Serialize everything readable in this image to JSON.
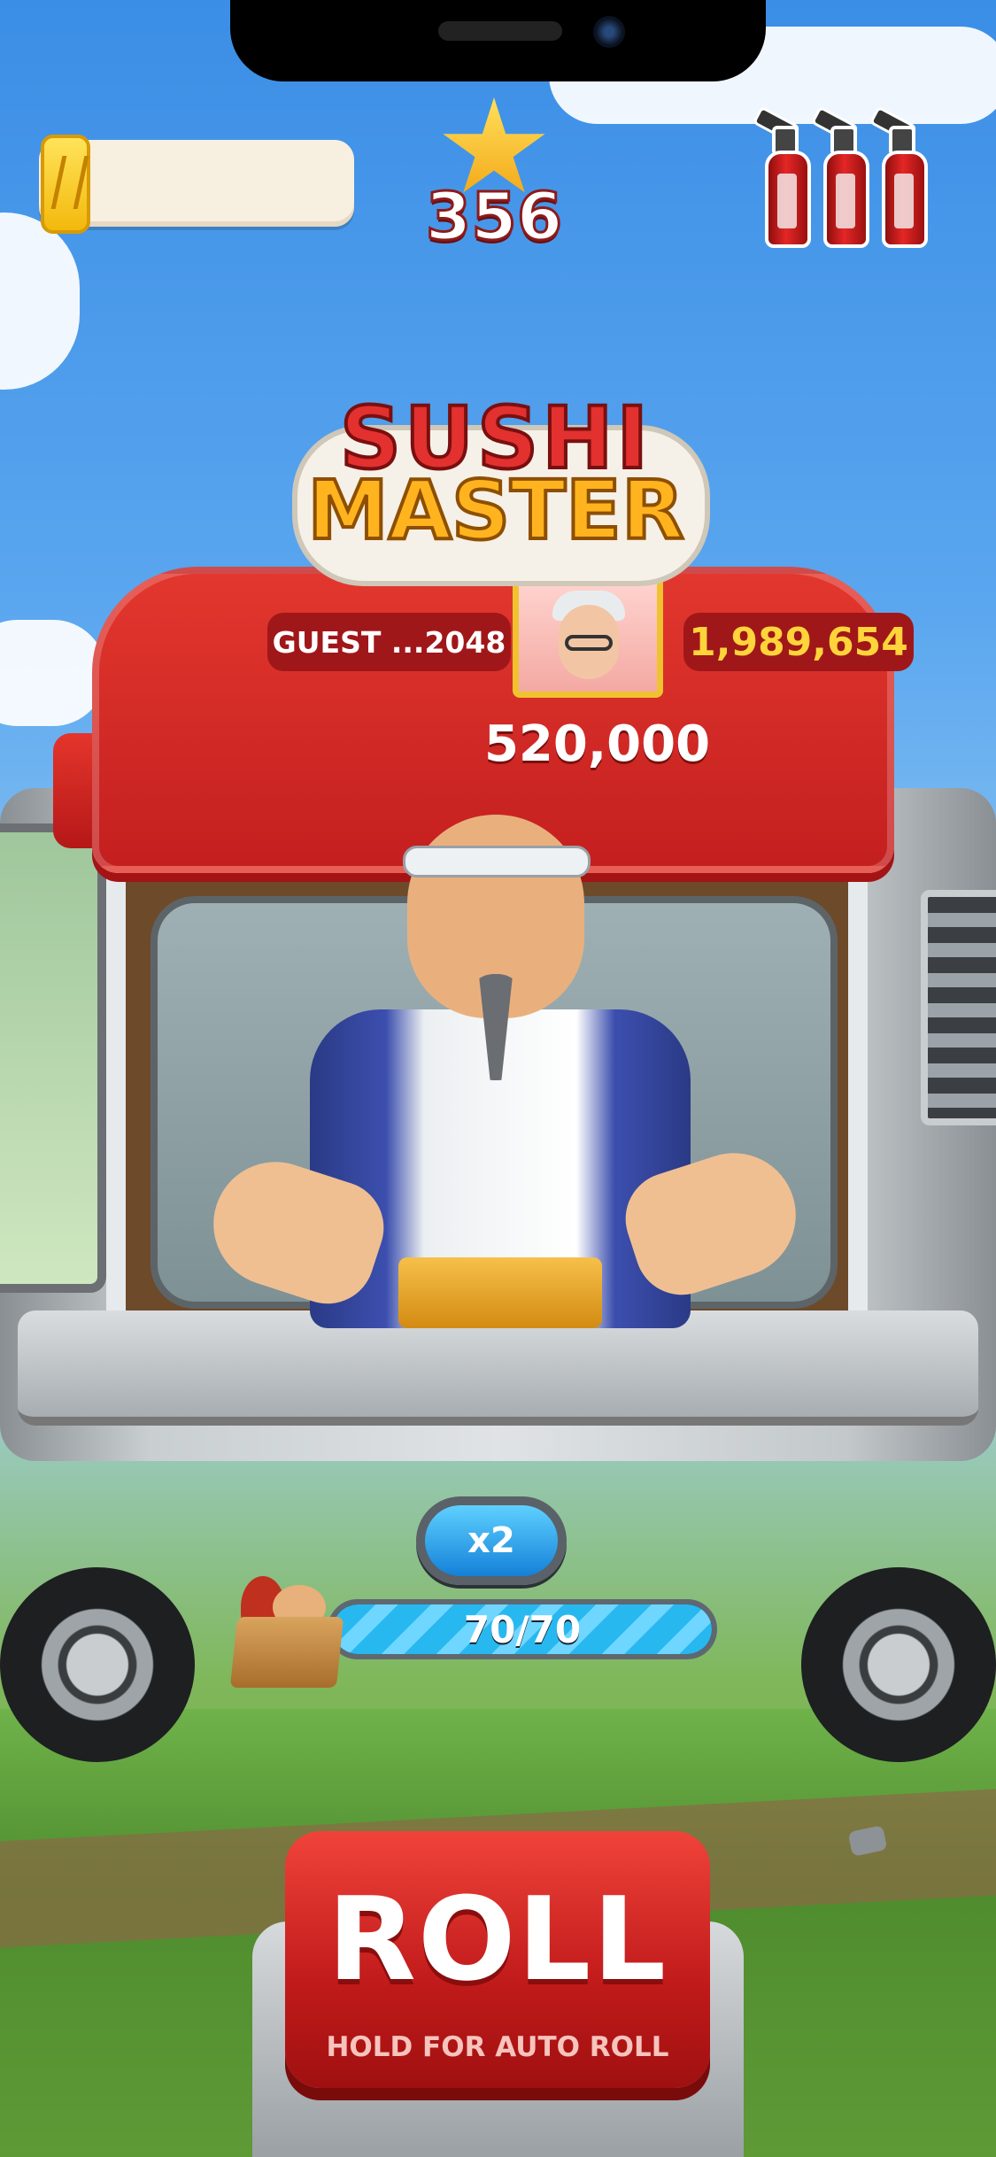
{
  "hud": {
    "coins_value": "",
    "stars": "356",
    "extinguishers_count": 3
  },
  "logo": {
    "line1": "SUSHI",
    "line2": "MASTER"
  },
  "leaderboard": {
    "player_name": "GUEST ...2048",
    "player_score": "1,989,654",
    "target_score": "520,000"
  },
  "multiplier": {
    "label": "x2"
  },
  "progress": {
    "text": "70/70",
    "current": 70,
    "max": 70
  },
  "roll_button": {
    "label": "ROLL",
    "sublabel": "HOLD FOR AUTO ROLL"
  },
  "colors": {
    "accent_red": "#c41f1f",
    "gold": "#ffd43b",
    "blue": "#1481d8"
  },
  "icons": [
    "coin-icon",
    "star-icon",
    "fire-extinguisher-icon",
    "avatar",
    "box-icon"
  ]
}
